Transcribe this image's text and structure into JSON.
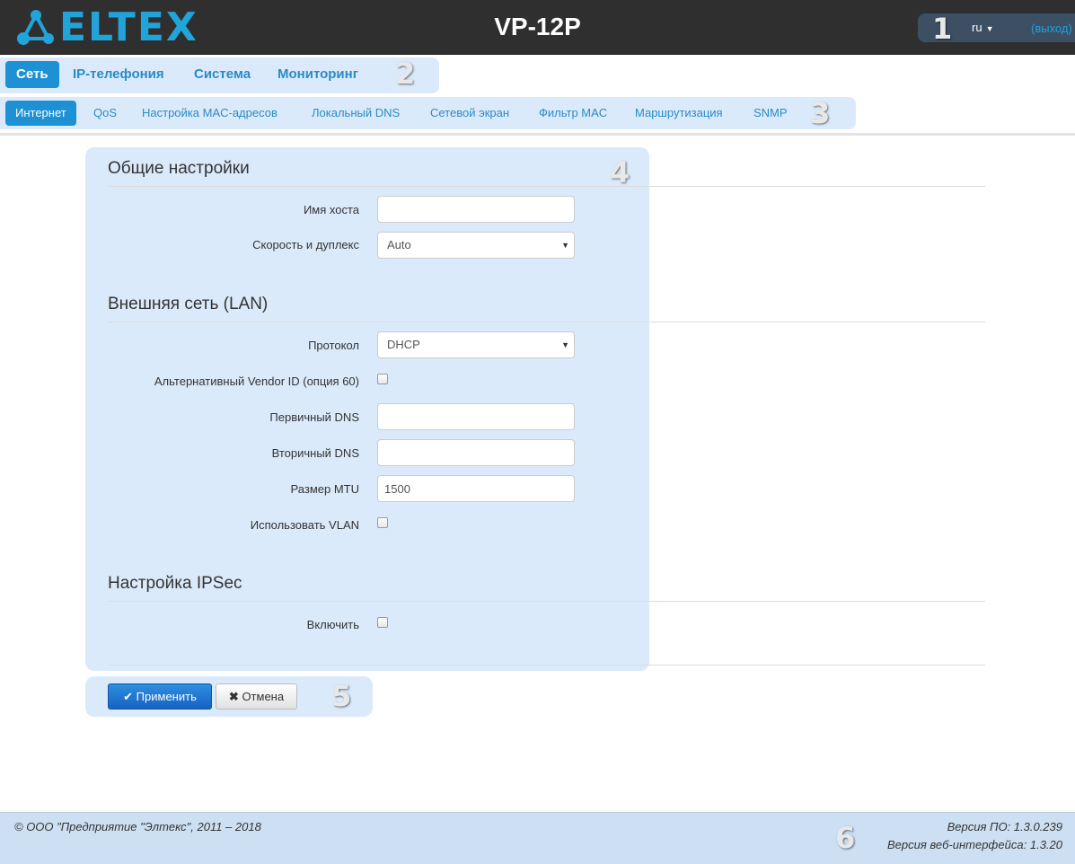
{
  "header": {
    "brand": "ELTEX",
    "device_title": "VP-12P",
    "language": "ru",
    "logout": "(выход)"
  },
  "markers": [
    "1",
    "2",
    "3",
    "4",
    "5",
    "6"
  ],
  "nav_main": {
    "items": [
      {
        "label": "Сеть",
        "active": true
      },
      {
        "label": "IP-телефония",
        "active": false
      },
      {
        "label": "Система",
        "active": false
      },
      {
        "label": "Мониторинг",
        "active": false
      }
    ]
  },
  "nav_sub": {
    "items": [
      {
        "label": "Интернет",
        "active": true
      },
      {
        "label": "QoS",
        "active": false
      },
      {
        "label": "Настройка MAC-адресов",
        "active": false
      },
      {
        "label": "Локальный DNS",
        "active": false
      },
      {
        "label": "Сетевой экран",
        "active": false
      },
      {
        "label": "Фильтр MAC",
        "active": false
      },
      {
        "label": "Маршрутизация",
        "active": false
      },
      {
        "label": "SNMP",
        "active": false
      }
    ]
  },
  "general": {
    "title": "Общие настройки",
    "hostname_label": "Имя хоста",
    "hostname_value": "",
    "speed_label": "Скорость и дуплекс",
    "speed_value": "Auto"
  },
  "lan": {
    "title": "Внешняя сеть (LAN)",
    "protocol_label": "Протокол",
    "protocol_value": "DHCP",
    "vendor_label": "Альтернативный Vendor ID (опция 60)",
    "vendor_checked": false,
    "dns1_label": "Первичный DNS",
    "dns1_value": "",
    "dns2_label": "Вторичный DNS",
    "dns2_value": "",
    "mtu_label": "Размер MTU",
    "mtu_value": "1500",
    "vlan_label": "Использовать VLAN",
    "vlan_checked": false
  },
  "ipsec": {
    "title": "Настройка IPSec",
    "enable_label": "Включить",
    "enable_checked": false
  },
  "buttons": {
    "apply": "Применить",
    "cancel": "Отмена"
  },
  "footer": {
    "copyright": "© ООО \"Предприятие \"Элтекс\", 2011 – 2018",
    "fw_version": "Версия ПО: 1.3.0.239",
    "web_version": "Версия веб-интерфейса: 1.3.20"
  },
  "colors": {
    "accent": "#1e90d4",
    "highlight": "#dbeafb",
    "header_bg": "#2f2f2f"
  }
}
